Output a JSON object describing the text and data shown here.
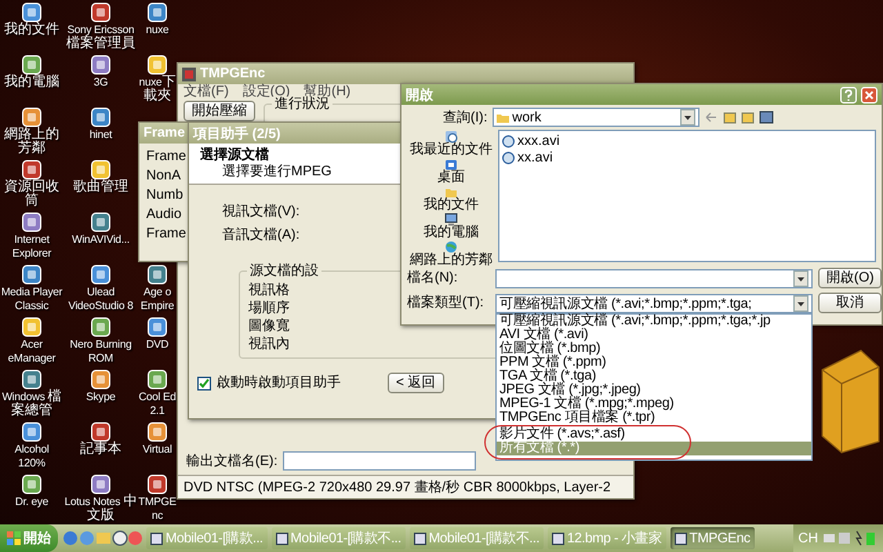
{
  "desktop_icons": {
    "column_1": [
      "我的文件",
      "我的電腦",
      "網路上的芳鄰",
      "資源回收筒",
      "Internet Explorer",
      "Media Player Classic",
      "Acer eManager",
      "Windows 檔案總管",
      "Alcohol 120%",
      "Dr. eye"
    ],
    "column_2": [
      "Sony Ericsson 檔案管理員",
      "3G",
      "hinet",
      "歌曲管理",
      "WinAVIVid...",
      "Ulead VideoStudio 8",
      "Nero Burning ROM",
      "Skype",
      "記事本",
      "Lotus Notes 中文版"
    ],
    "column_3": [
      "nuxe",
      "nuxe下載夾",
      "Age o Empire",
      "DVD",
      "Cool Ed 2.1",
      "Virtual",
      "TMPGEnc"
    ]
  },
  "main_window": {
    "title": "TMPGEnc",
    "menu": [
      "文檔(F)",
      "設定(O)",
      "幫助(H)"
    ],
    "start_button": "開始壓縮",
    "progress_group": "進行狀況",
    "output_label": "輸出文檔名(E):",
    "status_text": "DVD NTSC (MPEG-2 720x480 29.97 畫格/秒 CBR 8000kbps, Layer-2"
  },
  "frames_window": {
    "title": "Frame",
    "items": [
      "Frame",
      "NonA",
      "Numb",
      "Audio",
      "Frame"
    ]
  },
  "wizard": {
    "title": "項目助手 (2/5)",
    "heading": "選擇源文檔",
    "subheading": "選擇要進行MPEG",
    "video_label": "視訊文檔(V):",
    "audio_label": "音訊文檔(A):",
    "group_title": "源文檔的設",
    "group_rows": [
      "視訊格",
      "場順序",
      "圖像寬",
      "視訊內"
    ],
    "startup_checkbox": {
      "label": "啟動時啟動項目助手",
      "checked": true
    },
    "back_button": "< 返回"
  },
  "open_dialog": {
    "title": "開啟",
    "look_in_label": "查詢(I):",
    "look_in_value": "work",
    "places": [
      "我最近的文件",
      "桌面",
      "我的文件",
      "我的電腦",
      "網路上的芳鄰"
    ],
    "files": [
      "xxx.avi",
      "xx.avi"
    ],
    "filename_label": "檔名(N):",
    "filetype_label": "檔案類型(T):",
    "filetype_value": "可壓縮視訊源文檔 (*.avi;*.bmp;*.ppm;*.tga;",
    "open_button": "開啟(O)",
    "cancel_button": "取消",
    "filetype_options": [
      {
        "label": "可壓縮視訊源文檔 (*.avi;*.bmp;*.ppm;*.tga;*.jp",
        "selected": false
      },
      {
        "label": "AVI 文檔 (*.avi)",
        "selected": false
      },
      {
        "label": "位圖文檔 (*.bmp)",
        "selected": false
      },
      {
        "label": "PPM 文檔 (*.ppm)",
        "selected": false
      },
      {
        "label": "TGA 文檔 (*.tga)",
        "selected": false
      },
      {
        "label": "JPEG 文檔 (*.jpg;*.jpeg)",
        "selected": false
      },
      {
        "label": "MPEG-1 文檔 (*.mpg;*.mpeg)",
        "selected": false
      },
      {
        "label": "TMPGEnc 項目檔案 (*.tpr)",
        "selected": false
      },
      {
        "label": "影片文件 (*.avs;*.asf)",
        "selected": false
      },
      {
        "label": "所有文檔 (*.*)",
        "selected": true
      }
    ]
  },
  "taskbar": {
    "start_button": "開始",
    "tasks": [
      {
        "label": "Mobile01-[購款...",
        "selected": false
      },
      {
        "label": "Mobile01-[購款不...",
        "selected": false
      },
      {
        "label": "Mobile01-[購款不...",
        "selected": false
      },
      {
        "label": "12.bmp - 小畫家",
        "selected": false
      },
      {
        "label": "TMPGEnc",
        "selected": true
      }
    ],
    "language": "CH"
  }
}
